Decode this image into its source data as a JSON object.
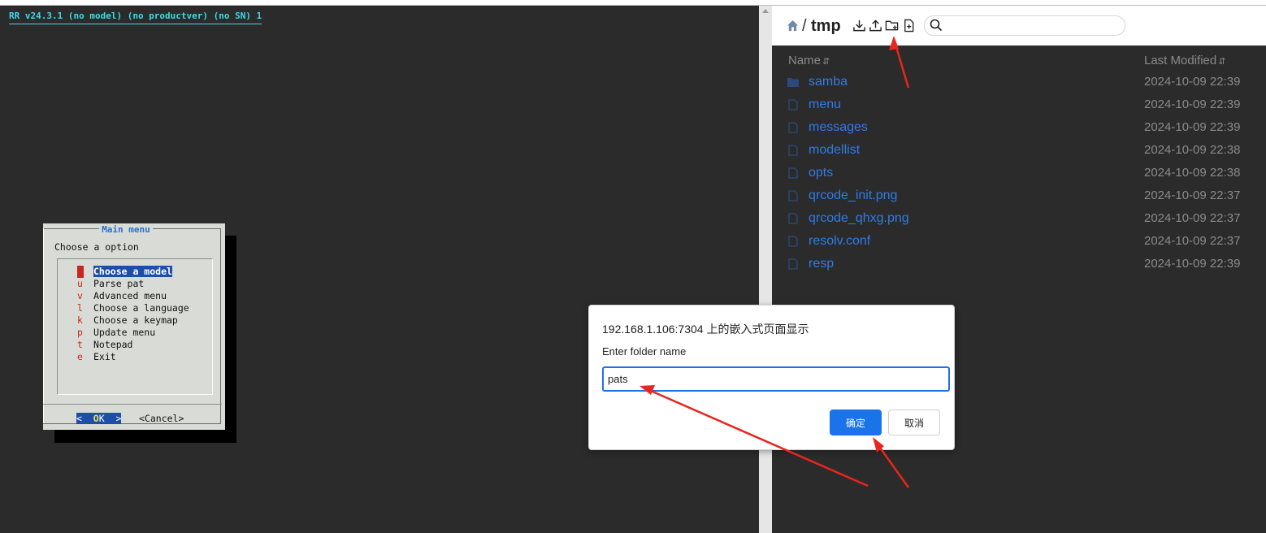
{
  "terminal": {
    "header": "RR v24.3.1 (no model) (no productver) (no SN) 1",
    "dialog": {
      "title": "Main menu",
      "prompt": "Choose a option",
      "items": [
        {
          "key": "m",
          "label": "Choose a model",
          "selected": true
        },
        {
          "key": "u",
          "label": "Parse pat"
        },
        {
          "key": "v",
          "label": "Advanced menu"
        },
        {
          "key": "l",
          "label": "Choose a language"
        },
        {
          "key": "k",
          "label": "Choose a keymap"
        },
        {
          "key": "p",
          "label": "Update menu"
        },
        {
          "key": "t",
          "label": "Notepad"
        },
        {
          "key": "e",
          "label": "Exit"
        }
      ],
      "ok_left": "<  ",
      "ok_hotkey": "O",
      "ok_rest": "K  >",
      "cancel": "<Cancel>"
    }
  },
  "filebrowser": {
    "breadcrumb_sep": "/",
    "current_dir": "tmp",
    "toolbar_icons": [
      "download-icon",
      "upload-icon",
      "new-folder-icon",
      "new-file-icon"
    ],
    "search": {
      "placeholder": "",
      "value": ""
    },
    "columns": {
      "name": "Name",
      "modified": "Last Modified",
      "sort_glyph": "⇵"
    },
    "files": [
      {
        "name": "samba",
        "modified": "2024-10-09 22:39",
        "type": "folder"
      },
      {
        "name": "menu",
        "modified": "2024-10-09 22:39",
        "type": "file"
      },
      {
        "name": "messages",
        "modified": "2024-10-09 22:39",
        "type": "file"
      },
      {
        "name": "modellist",
        "modified": "2024-10-09 22:38",
        "type": "file"
      },
      {
        "name": "opts",
        "modified": "2024-10-09 22:38",
        "type": "file"
      },
      {
        "name": "qrcode_init.png",
        "modified": "2024-10-09 22:37",
        "type": "file"
      },
      {
        "name": "qrcode_qhxg.png",
        "modified": "2024-10-09 22:37",
        "type": "file"
      },
      {
        "name": "resolv.conf",
        "modified": "2024-10-09 22:37",
        "type": "file"
      },
      {
        "name": "resp",
        "modified": "2024-10-09 22:39",
        "type": "file"
      }
    ]
  },
  "prompt": {
    "title": "192.168.1.106:7304 上的嵌入式页面显示",
    "message": "Enter folder name",
    "value": "pats",
    "ok_label": "确定",
    "cancel_label": "取消"
  },
  "colors": {
    "accent": "#1a73e8",
    "link": "#2f7be8",
    "terminal_header": "#40d8e8",
    "annotation_arrow": "#e8251e"
  }
}
